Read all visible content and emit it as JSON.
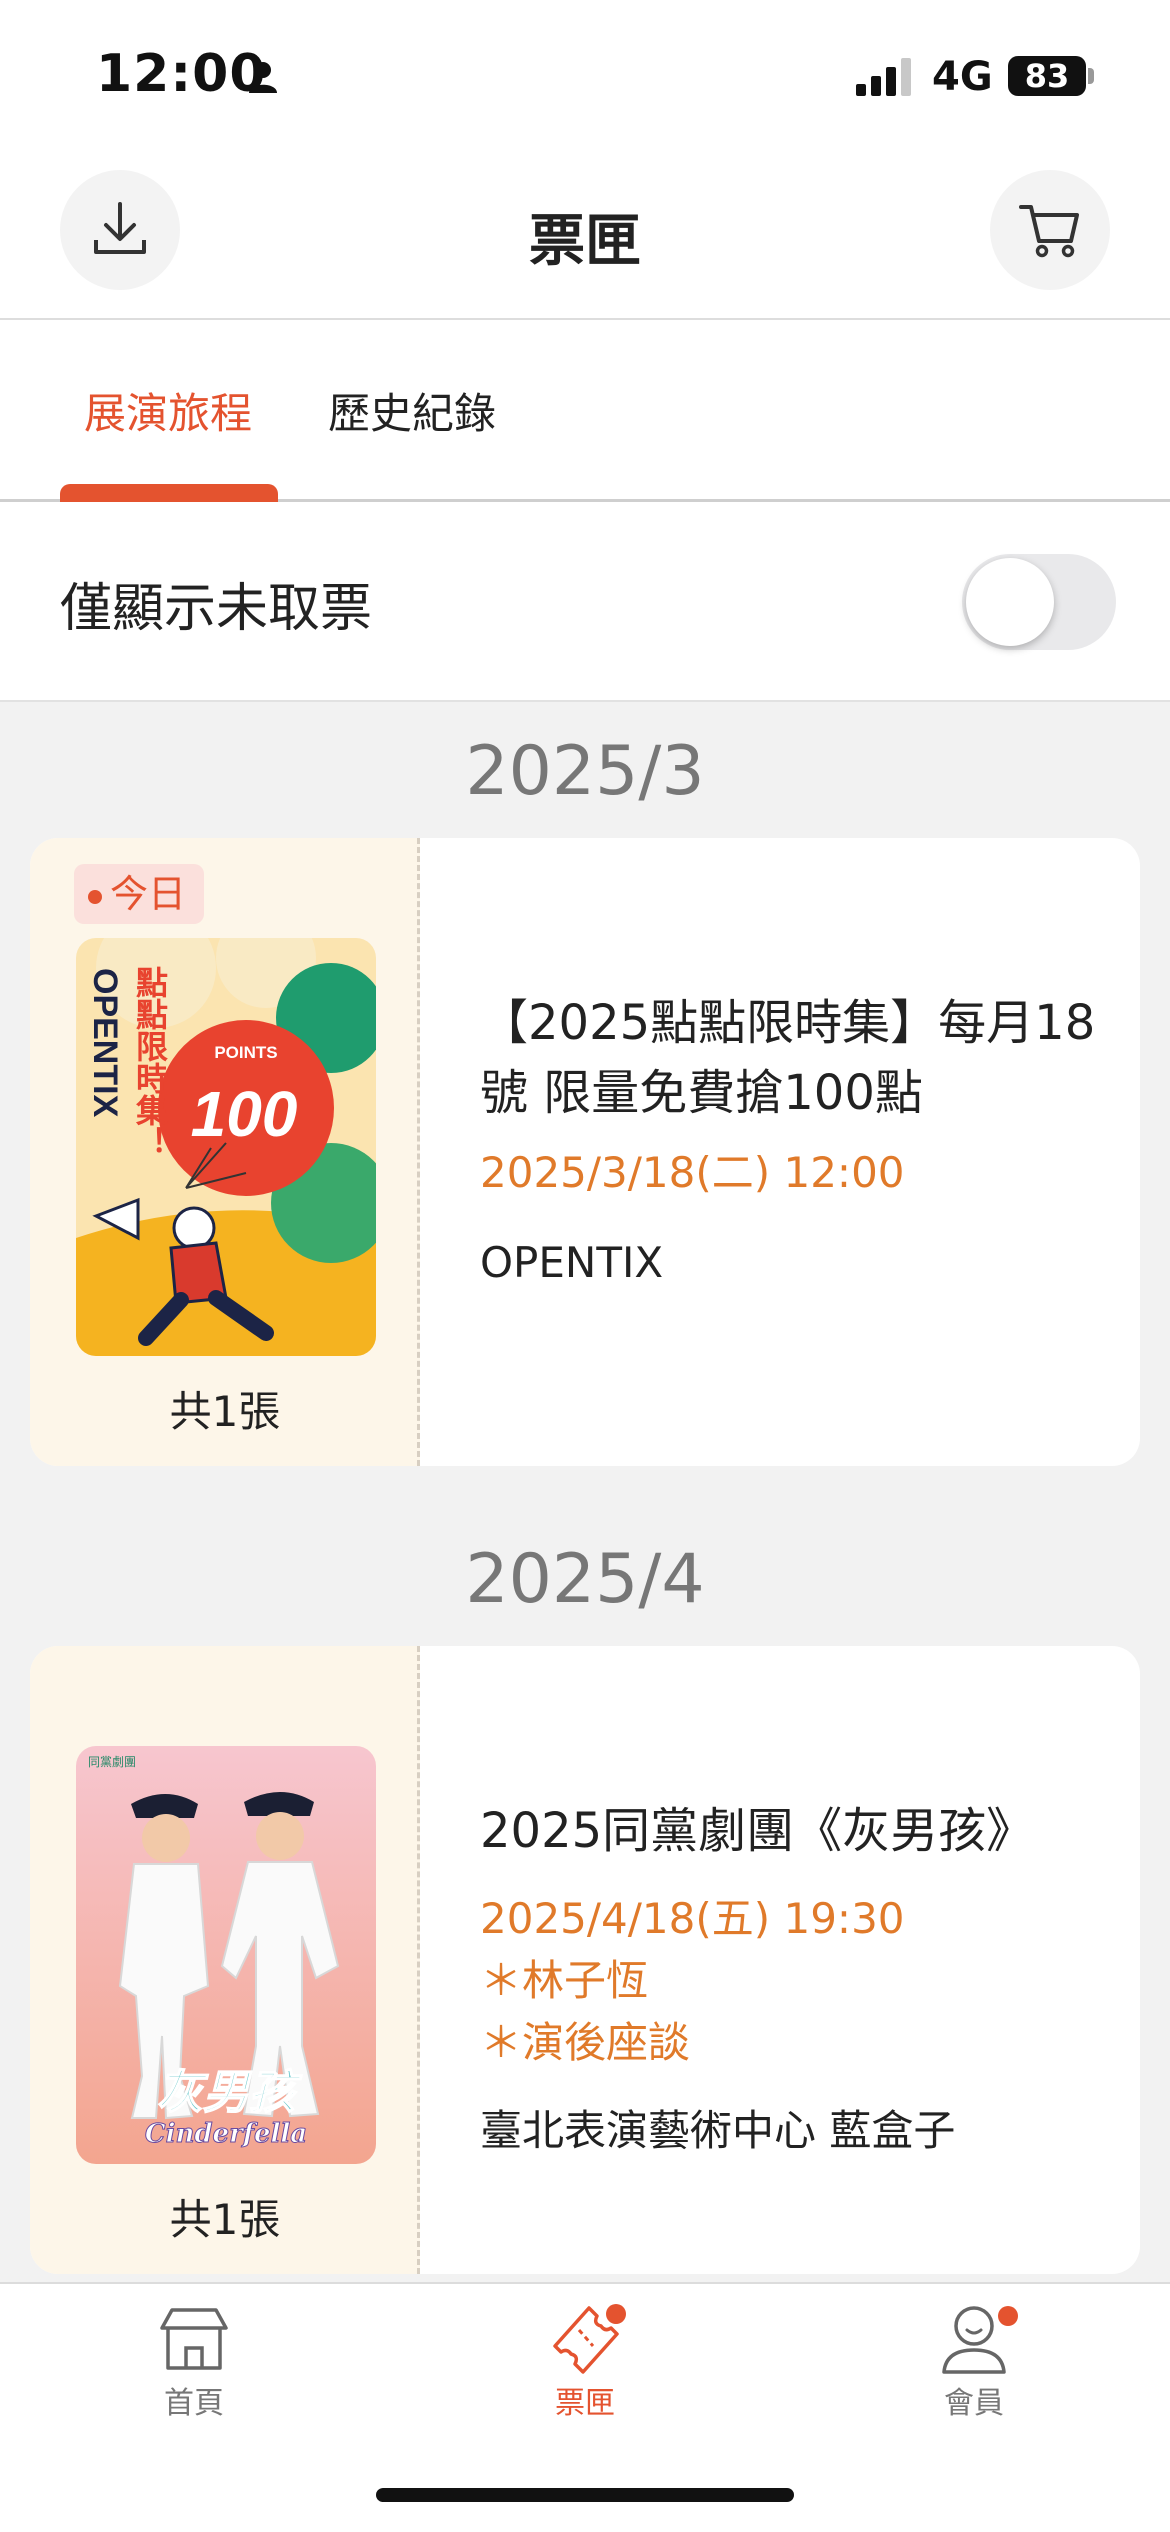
{
  "status": {
    "time": "12:00",
    "network": "4G",
    "battery": "83"
  },
  "header": {
    "title": "票匣"
  },
  "tabs": [
    {
      "label": "展演旅程"
    },
    {
      "label": "歷史紀錄"
    }
  ],
  "filter": {
    "label": "僅顯示未取票",
    "enabled": false
  },
  "groups": [
    {
      "month": "2025/3",
      "event": {
        "badge": "今日",
        "poster_text": {
          "brand": "OPENTIX",
          "slogan": "點點限時集！",
          "points_label": "POINTS",
          "points": "100"
        },
        "ticket_count": "共1張",
        "title": "【2025點點限時集】每月18號 限量免費搶100點",
        "date": "2025/3/18(二) 12:00",
        "venue": "OPENTIX"
      }
    },
    {
      "month": "2025/4",
      "event": {
        "poster_text": {
          "logo_cn": "灰男孩",
          "logo_en": "Cinderfella",
          "corner": "同黨劇團"
        },
        "ticket_count": "共1張",
        "title": "2025同黨劇團《灰男孩》",
        "date": "2025/4/18(五) 19:30",
        "tags": [
          "＊林子恆",
          "＊演後座談"
        ],
        "venue": "臺北表演藝術中心 藍盒子"
      }
    }
  ],
  "tabbar": [
    {
      "label": "首頁",
      "icon": "home-icon"
    },
    {
      "label": "票匣",
      "icon": "ticket-icon"
    },
    {
      "label": "會員",
      "icon": "member-icon"
    }
  ],
  "colors": {
    "accent": "#e4532f",
    "date": "#e07a2a"
  }
}
